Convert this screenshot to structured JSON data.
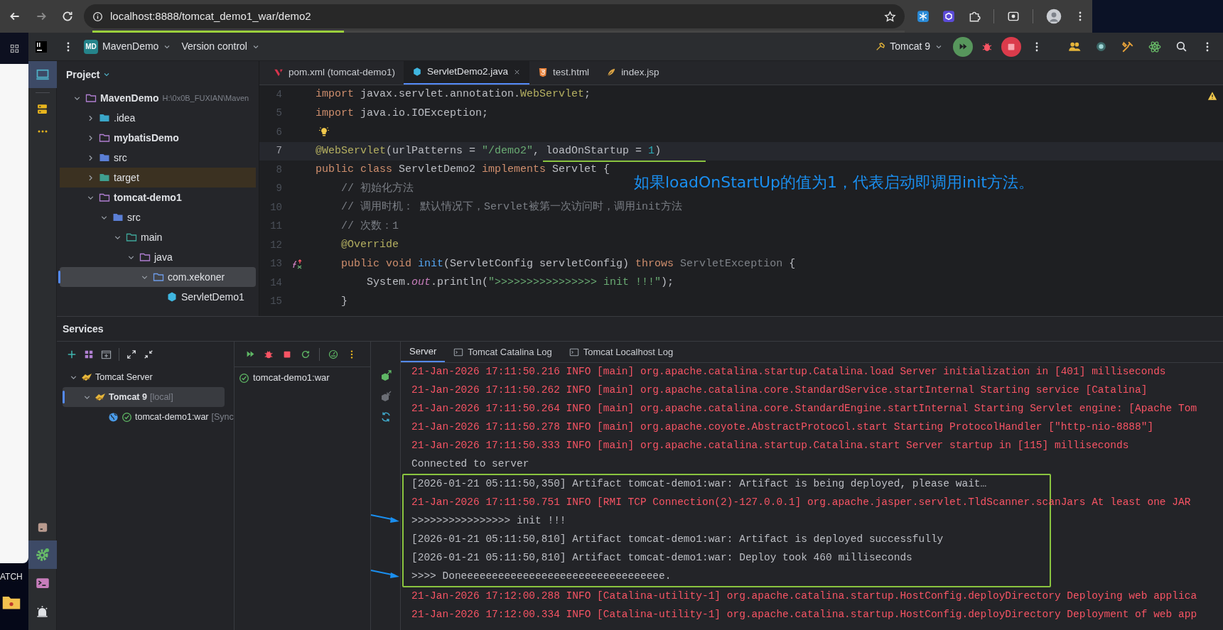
{
  "browser": {
    "url": "localhost:8888/tomcat_demo1_war/demo2",
    "loading": {
      "level": 0.31
    }
  },
  "desktop": {
    "taskbar_text": "ATCH"
  },
  "ide": {
    "project_badge": "MD",
    "project_name": "MavenDemo",
    "vcs": "Version control",
    "run_config": "Tomcat 9"
  },
  "project_panel": {
    "title": "Project",
    "tree": [
      {
        "label": "MavenDemo",
        "hint": "H:\\0x0B_FUXIAN\\Maven",
        "kind": "module",
        "expanded": true,
        "selected": false,
        "children": [
          {
            "label": ".idea",
            "kind": "idea",
            "expanded": false,
            "selected": false
          },
          {
            "label": "mybatisDemo",
            "kind": "module",
            "expanded": false,
            "selected": false
          },
          {
            "label": "src",
            "kind": "source",
            "expanded": false,
            "selected": false
          },
          {
            "label": "target",
            "kind": "excluded",
            "expanded": false,
            "selected": false
          },
          {
            "label": "tomcat-demo1",
            "kind": "module",
            "expanded": true,
            "selected": false,
            "children": [
              {
                "label": "src",
                "kind": "source",
                "expanded": true,
                "selected": false,
                "children": [
                  {
                    "label": "main",
                    "kind": "main",
                    "expanded": true,
                    "selected": false,
                    "children": [
                      {
                        "label": "java",
                        "kind": "java",
                        "expanded": true,
                        "selected": false,
                        "children": [
                          {
                            "label": "com.xekoner",
                            "kind": "package",
                            "expanded": true,
                            "selected": true,
                            "children": [
                              {
                                "label": "ServletDemo1",
                                "kind": "class",
                                "selected": false
                              }
                            ]
                          }
                        ]
                      }
                    ]
                  }
                ]
              }
            ]
          }
        ]
      }
    ]
  },
  "editor": {
    "tabs": [
      {
        "label": "pom.xml (tomcat-demo1)",
        "kind": "maven",
        "selected": false
      },
      {
        "label": "ServletDemo2.java",
        "kind": "java",
        "selected": true
      },
      {
        "label": "test.html",
        "kind": "html",
        "selected": false
      },
      {
        "label": "index.jsp",
        "kind": "jsp",
        "selected": false
      }
    ],
    "lines": [
      {
        "number": "4",
        "current": false,
        "tokens": [
          {
            "text": "import",
            "kind": "kw"
          },
          {
            "text": " javax.servlet.annotation.",
            "kind": "plain"
          },
          {
            "text": "WebServlet",
            "kind": "ann"
          },
          {
            "text": ";",
            "kind": "plain"
          }
        ]
      },
      {
        "number": "5",
        "current": false,
        "tokens": [
          {
            "text": "import",
            "kind": "kw"
          },
          {
            "text": " java.io.IOException;",
            "kind": "plain"
          }
        ]
      },
      {
        "number": "6",
        "current": false,
        "kind": "bulb"
      },
      {
        "number": "7",
        "current": true,
        "tokens": [
          {
            "text": "@WebServlet",
            "kind": "ann"
          },
          {
            "text": "(urlPatterns = ",
            "kind": "plain"
          },
          {
            "text": "\"/demo2\"",
            "kind": "str"
          },
          {
            "text": ", loadOnStartup = ",
            "kind": "plain"
          },
          {
            "text": "1",
            "kind": "num"
          },
          {
            "text": ")",
            "kind": "plain"
          }
        ]
      },
      {
        "number": "8",
        "current": false,
        "tokens": [
          {
            "text": "public class ",
            "kind": "kw"
          },
          {
            "text": "ServletDemo2 ",
            "kind": "plain"
          },
          {
            "text": "implements ",
            "kind": "kw"
          },
          {
            "text": "Servlet {",
            "kind": "plain"
          }
        ]
      },
      {
        "number": "9",
        "current": false,
        "tokens": [
          {
            "text": "    // 初始化方法",
            "kind": "cm"
          }
        ]
      },
      {
        "number": "10",
        "current": false,
        "tokens": [
          {
            "text": "    // 调用时机： 默认情况下，Servlet被第一次访问时，调用init方法",
            "kind": "cm"
          }
        ]
      },
      {
        "number": "11",
        "current": false,
        "tokens": [
          {
            "text": "    // 次数：1",
            "kind": "cm"
          }
        ]
      },
      {
        "number": "12",
        "current": false,
        "tokens": [
          {
            "text": "    @Override",
            "kind": "ann"
          }
        ]
      },
      {
        "number": "13",
        "current": false,
        "kind": "override",
        "tokens": [
          {
            "text": "    public void ",
            "kind": "kw"
          },
          {
            "text": "init",
            "kind": "fn"
          },
          {
            "text": "(ServletConfig servletConfig) ",
            "kind": "plain"
          },
          {
            "text": "throws ",
            "kind": "kw"
          },
          {
            "text": "ServletException",
            "kind": "dim"
          },
          {
            "text": " {",
            "kind": "plain"
          }
        ]
      },
      {
        "number": "14",
        "current": false,
        "tokens": [
          {
            "text": "        System.",
            "kind": "plain"
          },
          {
            "text": "out",
            "kind": "field"
          },
          {
            "text": ".println(",
            "kind": "plain"
          },
          {
            "text": "\">>>>>>>>>>>>>>>> init !!!\"",
            "kind": "str"
          },
          {
            "text": ");",
            "kind": "plain"
          }
        ]
      },
      {
        "number": "15",
        "current": false,
        "tokens": [
          {
            "text": "    }",
            "kind": "plain"
          }
        ]
      }
    ],
    "annotation": "如果loadOnStartUp的值为1，代表启动即调用init方法。"
  },
  "services": {
    "title": "Services",
    "tree": [
      {
        "label": "Tomcat Server",
        "kind": "group",
        "expanded": true,
        "selected": false,
        "children": [
          {
            "label": "Tomcat 9",
            "hint": "[local]",
            "kind": "server",
            "expanded": true,
            "selected": true,
            "children": [
              {
                "label": "tomcat-demo1:war",
                "hint": "[Sync",
                "kind": "artifact",
                "selected": false
              }
            ]
          }
        ]
      }
    ],
    "deployments": [
      {
        "label": "tomcat-demo1:war"
      }
    ],
    "log_tabs": [
      {
        "label": "Server",
        "kind": "plain",
        "selected": true
      },
      {
        "label": "Tomcat Catalina Log",
        "kind": "log",
        "selected": false
      },
      {
        "label": "Tomcat Localhost Log",
        "kind": "log",
        "selected": false
      }
    ],
    "log": [
      {
        "kind": "line",
        "text": "21-Jan-2026 17:11:50.216 INFO [main] org.apache.catalina.startup.Catalina.load Server initialization in [401] milliseconds",
        "color": "#f75464"
      },
      {
        "kind": "line",
        "text": "21-Jan-2026 17:11:50.262 INFO [main] org.apache.catalina.core.StandardService.startInternal Starting service [Catalina]",
        "color": "#f75464"
      },
      {
        "kind": "line",
        "text": "21-Jan-2026 17:11:50.264 INFO [main] org.apache.catalina.core.StandardEngine.startInternal Starting Servlet engine: [Apache Tom",
        "color": "#f75464"
      },
      {
        "kind": "line",
        "text": "21-Jan-2026 17:11:50.278 INFO [main] org.apache.coyote.AbstractProtocol.start Starting ProtocolHandler [\"http-nio-8888\"]",
        "color": "#f75464"
      },
      {
        "kind": "line",
        "text": "21-Jan-2026 17:11:50.333 INFO [main] org.apache.catalina.startup.Catalina.start Server startup in [115] milliseconds",
        "color": "#f75464"
      },
      {
        "kind": "line",
        "text": "Connected to server",
        "color": "#bcbec4"
      },
      {
        "kind": "group",
        "boxed": true,
        "lines": [
          {
            "text": "[2026-01-21 05:11:50,350] Artifact tomcat-demo1:war: Artifact is being deployed, please wait…",
            "color": "#bcbec4"
          },
          {
            "text": "21-Jan-2026 17:11:50.751 INFO [RMI TCP Connection(2)-127.0.0.1] org.apache.jasper.servlet.TldScanner.scanJars At least one JAR",
            "color": "#f75464"
          },
          {
            "text": ">>>>>>>>>>>>>>>> init !!!",
            "color": "#bcbec4",
            "arrow": true
          },
          {
            "text": "[2026-01-21 05:11:50,810] Artifact tomcat-demo1:war: Artifact is deployed successfully",
            "color": "#bcbec4"
          },
          {
            "text": "[2026-01-21 05:11:50,810] Artifact tomcat-demo1:war: Deploy took 460 milliseconds",
            "color": "#bcbec4"
          },
          {
            "text": ">>>> Doneeeeeeeeeeeeeeeeeeeeeeeeeeeeeeeee.",
            "color": "#bcbec4",
            "arrow": true
          }
        ]
      },
      {
        "kind": "line",
        "text": "21-Jan-2026 17:12:00.288 INFO [Catalina-utility-1] org.apache.catalina.startup.HostConfig.deployDirectory Deploying web applica",
        "color": "#f75464"
      },
      {
        "kind": "line",
        "text": "21-Jan-2026 17:12:00.334 INFO [Catalina-utility-1] org.apache.catalina.startup.HostConfig.deployDirectory Deployment of web app",
        "color": "#f75464"
      }
    ]
  }
}
